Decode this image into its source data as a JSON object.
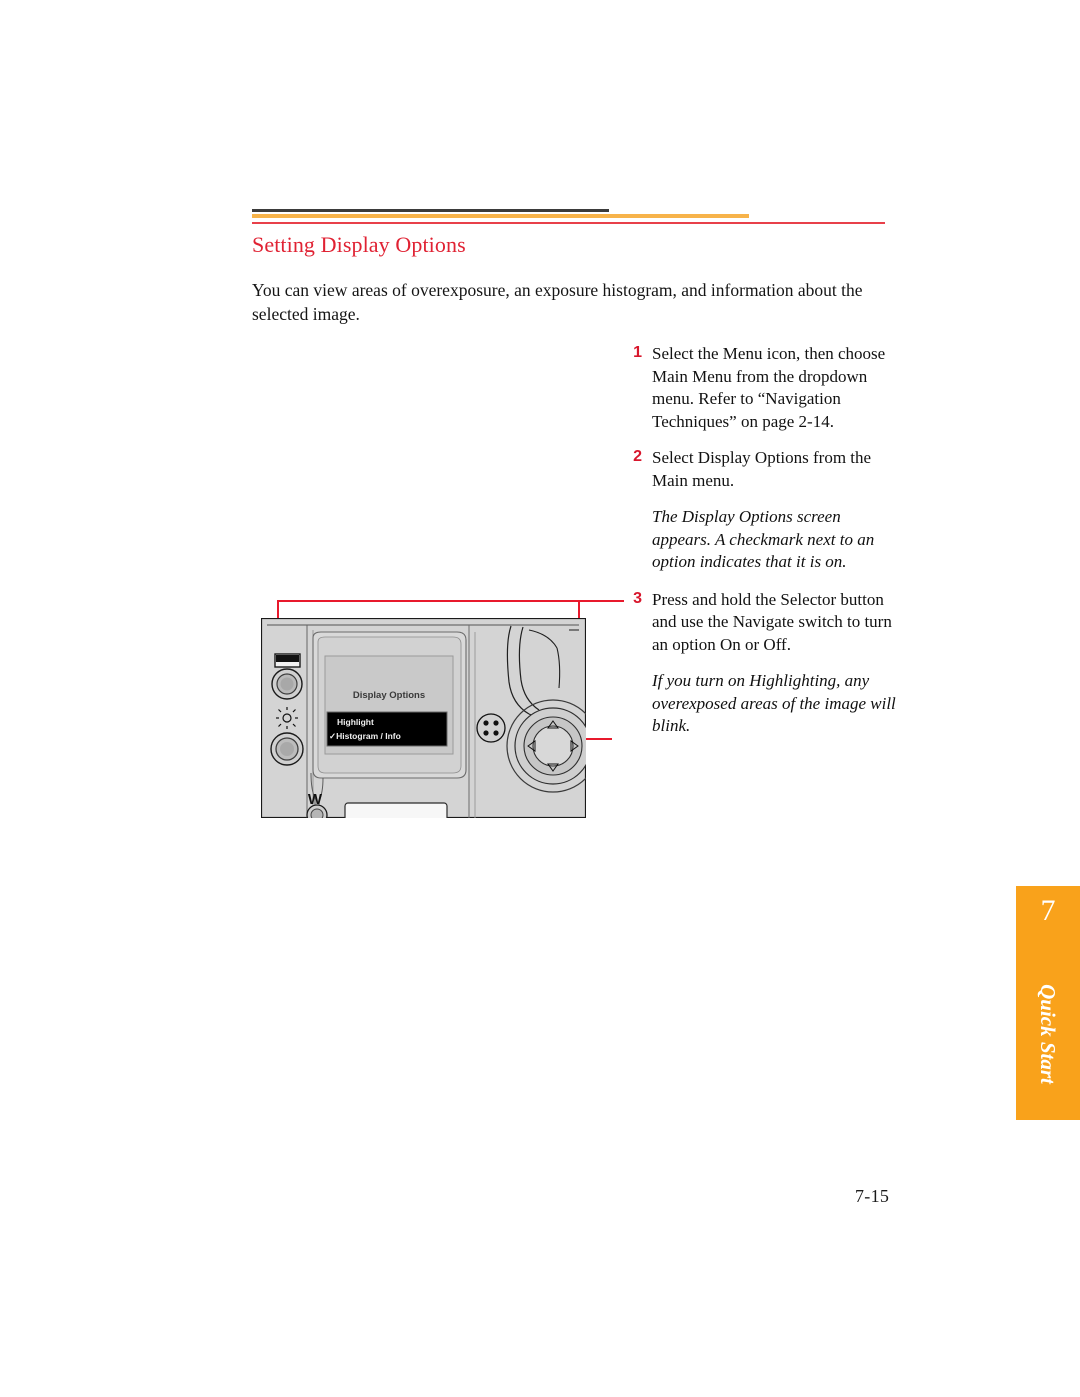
{
  "document": {
    "section_title": "Setting Display Options",
    "intro": "You can view areas of overexposure, an exposure histogram, and information about the selected image.",
    "page_number": "7-15"
  },
  "rules": {
    "dark_color": "#3b3b3b",
    "gold_color": "#f7b34a",
    "red_color": "#e8404a"
  },
  "colors": {
    "title_red": "#e02233",
    "step_number_red": "#d8162c",
    "callout_red": "#e8192c",
    "tab_orange": "#f9a21b",
    "body_text": "#151515"
  },
  "steps": [
    {
      "number": "1",
      "text": "Select the Menu icon, then choose Main Menu from the dropdown menu. Refer to “Navigation Techniques” on page 2-14."
    },
    {
      "number": "2",
      "text": "Select Display Options from the Main menu."
    },
    {
      "number": "3",
      "text": "Press and hold the Selector button and use the Navigate switch to turn an option On or Off."
    }
  ],
  "notes": [
    "The Display Options screen appears. A checkmark next to an option indicates that it is on.",
    "If you turn on Highlighting, any overexposed areas of the image will blink."
  ],
  "camera_illustration": {
    "lcd_title": "Display Options",
    "menu_items": [
      {
        "check": "",
        "label": "Highlight"
      },
      {
        "check": "✓",
        "label": "Histogram / Info"
      }
    ],
    "zoom_wide_icon": "W",
    "body_color": "#d4d4d4",
    "lcd_color": "#c9c9c9",
    "menu_box_color": "#000000"
  },
  "chapter_tab": {
    "number": "7",
    "label": "Quick Start"
  }
}
